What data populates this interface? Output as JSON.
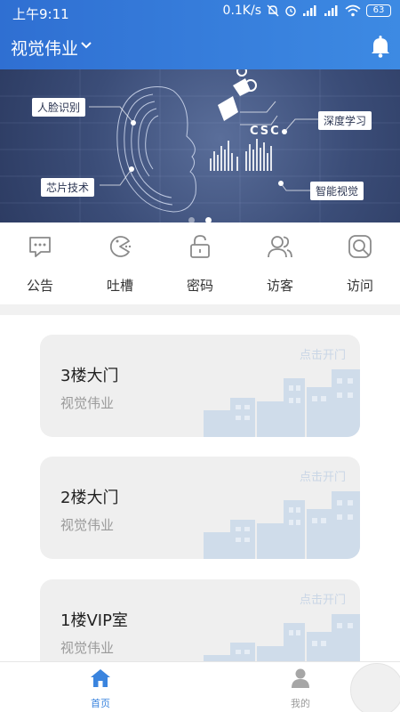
{
  "status_bar": {
    "time": "上午9:11",
    "speed": "0.1K/s",
    "battery": "63"
  },
  "header": {
    "title": "视觉伟业"
  },
  "banner": {
    "labels": [
      "人脸识别",
      "芯片技术",
      "深度学习",
      "智能视觉"
    ],
    "logo_text": "CSC"
  },
  "menu": {
    "items": [
      {
        "label": "公告",
        "icon": "message-icon"
      },
      {
        "label": "吐槽",
        "icon": "pacman-chat-icon"
      },
      {
        "label": "密码",
        "icon": "lock-icon"
      },
      {
        "label": "访客",
        "icon": "users-icon"
      },
      {
        "label": "访问",
        "icon": "search-icon"
      }
    ]
  },
  "doors": [
    {
      "name": "3楼大门",
      "company": "视觉伟业",
      "action": "点击开门"
    },
    {
      "name": "2楼大门",
      "company": "视觉伟业",
      "action": "点击开门"
    },
    {
      "name": "1楼VIP室",
      "company": "视觉伟业",
      "action": "点击开门"
    }
  ],
  "tabbar": {
    "home": "首页",
    "mine": "我的"
  },
  "colors": {
    "primary": "#3a84de",
    "tab_active": "#3a84de",
    "tab_inactive": "#9b9b9b",
    "card_bg": "#efefef"
  }
}
